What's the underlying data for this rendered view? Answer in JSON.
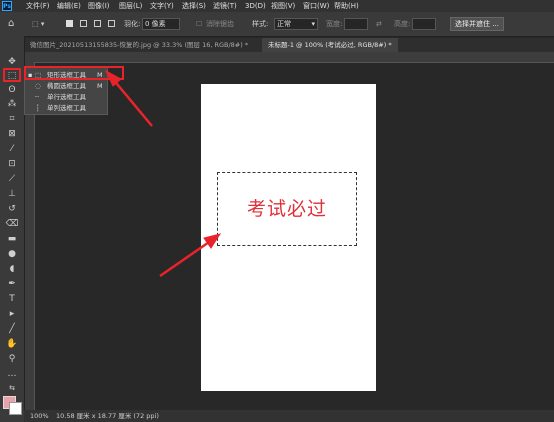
{
  "app": {
    "logo": "Ps"
  },
  "menu": [
    "文件(F)",
    "编辑(E)",
    "图像(I)",
    "图层(L)",
    "文字(Y)",
    "选择(S)",
    "滤镜(T)",
    "3D(D)",
    "视图(V)",
    "窗口(W)",
    "帮助(H)"
  ],
  "options": {
    "feather_label": "羽化:",
    "feather_value": "0 像素",
    "antialias_label": "消除锯齿",
    "style_label": "样式:",
    "style_value": "正常",
    "width_label": "宽度:",
    "height_label": "高度:",
    "select_mask_button": "选择并遮住 ..."
  },
  "tabs": [
    {
      "label": "微信图片_20210513155835-恢复的.jpg @ 33.3% (图层 16, RGB/8#) *",
      "active": false
    },
    {
      "label": "未标题-1 @ 100% (考试必过, RGB/8#) *",
      "active": true
    }
  ],
  "flyout": {
    "items": [
      {
        "label": "矩形选框工具",
        "shortcut": "M"
      },
      {
        "label": "椭圆选框工具",
        "shortcut": "M"
      },
      {
        "label": "单行选框工具",
        "shortcut": ""
      },
      {
        "label": "单列选框工具",
        "shortcut": ""
      }
    ]
  },
  "canvas": {
    "text": "考试必过",
    "text_color": "#e0303a"
  },
  "status": {
    "zoom": "100%",
    "info": "10.58 厘米 x 18.77 厘米 (72 ppi)"
  },
  "colors": {
    "accent": "#e8242a",
    "foreground": "#e8a2a8",
    "background": "#ffffff"
  },
  "toolbar_icons": [
    "move-icon",
    "marquee-icon",
    "lasso-icon",
    "magic-wand-icon",
    "crop-icon",
    "frame-icon",
    "eyedropper-icon",
    "healing-brush-icon",
    "brush-icon",
    "clone-stamp-icon",
    "history-brush-icon",
    "eraser-icon",
    "gradient-icon",
    "blur-icon",
    "dodge-icon",
    "pen-icon",
    "type-icon",
    "path-selection-icon",
    "line-icon",
    "hand-icon",
    "zoom-icon",
    "more-tools-icon"
  ]
}
